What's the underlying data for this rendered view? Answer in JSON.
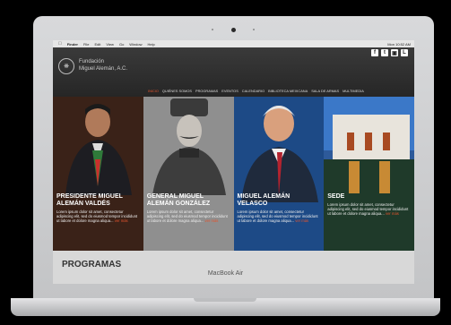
{
  "menubar": {
    "app": "Finder",
    "items": [
      "File",
      "Edit",
      "View",
      "Go",
      "Window",
      "Help"
    ],
    "clock": "Mon 10:52 AM"
  },
  "header": {
    "org_line1": "Fundación",
    "org_line2": "Miguel Alemán, A.C.",
    "social": [
      "f",
      "t",
      "▣",
      "L"
    ]
  },
  "nav": [
    "INICIO",
    "QUIÉNES SOMOS",
    "PROGRAMAS",
    "EVENTOS",
    "CALENDARIO",
    "BIBLIOTECA MEXICANA",
    "SALA DE ARMAS",
    "MULTIMEDIA"
  ],
  "panels": [
    {
      "title_line1": "PRESIDENTE MIGUEL",
      "title_line2": "ALEMÁN VALDÉS",
      "body": "Lorem ipsum dolor sit amet, consectetur adipiscing elit, sed do eiusmod tempor incididunt ut labore et dolore magna aliqua...",
      "more": "ver más"
    },
    {
      "title_line1": "GENERAL MIGUEL",
      "title_line2": "ALEMÁN GONZÁLEZ",
      "body": "Lorem ipsum dolor sit amet, consectetur adipiscing elit, sed do eiusmod tempor incididunt ut labore et dolore magna aliqua...",
      "more": "ver más"
    },
    {
      "title_line1": "MIGUEL ALEMÁN",
      "title_line2": "VELASCO",
      "body": "Lorem ipsum dolor sit amet, consectetur adipiscing elit, sed do eiusmod tempor incididunt ut labore et dolore magna aliqua...",
      "more": "ver más"
    },
    {
      "title_line1": "SEDE",
      "title_line2": "",
      "body": "Lorem ipsum dolor sit amet, consectetur adipiscing elit, sed do eiusmod tempor incididunt ut labore et dolore magna aliqua...",
      "more": "ver más"
    }
  ],
  "section_title": "PROGRAMAS",
  "laptop_label": "MacBook Air",
  "colors": {
    "accent": "#e5542d",
    "header_bg": "#2e2e2e",
    "section_bg": "#d8d8d8"
  }
}
